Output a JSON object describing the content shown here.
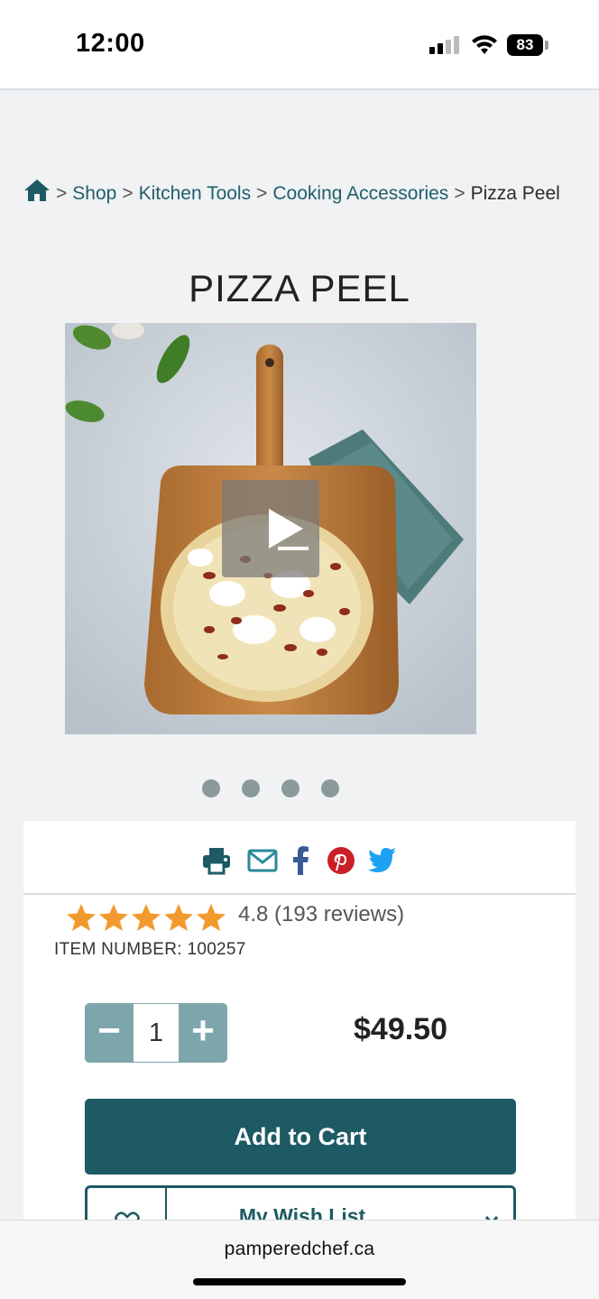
{
  "status_bar": {
    "time": "12:00",
    "battery": "83"
  },
  "breadcrumb": {
    "items": [
      "Shop",
      "Kitchen Tools",
      "Cooking Accessories"
    ],
    "current": "Pizza Peel",
    "separator": ">"
  },
  "product": {
    "title": "PIZZA PEEL",
    "image_count": 4,
    "active_image": 0,
    "rating_value": 4.8,
    "rating_text": "4.8 (193 reviews)",
    "item_number": "ITEM NUMBER: 100257",
    "quantity": "1",
    "price": "$49.50"
  },
  "actions": {
    "add_to_cart": "Add to Cart",
    "wish_list": "My Wish List",
    "qty_minus": "−",
    "qty_plus": "+"
  },
  "share": {
    "icons": [
      "print-icon",
      "email-icon",
      "facebook-icon",
      "pinterest-icon",
      "twitter-icon"
    ]
  },
  "browser": {
    "url": "pamperedchef.ca"
  },
  "colors": {
    "brand_teal": "#1d5a63",
    "link_teal": "#215f6b",
    "star_orange": "#f29a2e",
    "qty_teal": "#7da6ac"
  }
}
